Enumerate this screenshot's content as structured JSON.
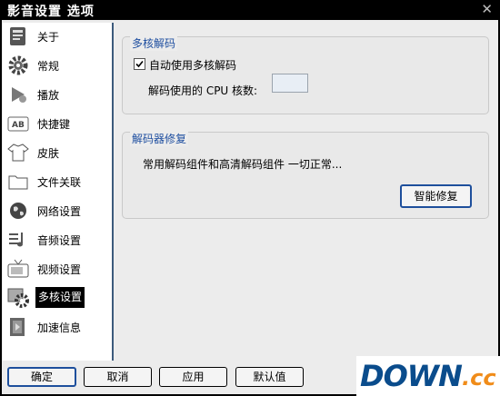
{
  "window": {
    "title": "影音设置 选项",
    "close_symbol": "✕"
  },
  "sidebar": {
    "items": [
      {
        "label": "关于",
        "icon": "about-icon"
      },
      {
        "label": "常规",
        "icon": "gear-icon"
      },
      {
        "label": "播放",
        "icon": "play-icon"
      },
      {
        "label": "快捷键",
        "icon": "keyboard-icon"
      },
      {
        "label": "皮肤",
        "icon": "shirt-icon"
      },
      {
        "label": "文件关联",
        "icon": "folder-icon"
      },
      {
        "label": "网络设置",
        "icon": "globe-icon"
      },
      {
        "label": "音频设置",
        "icon": "audio-icon"
      },
      {
        "label": "视频设置",
        "icon": "tv-icon"
      },
      {
        "label": "多核设置",
        "icon": "multicore-icon",
        "selected": true
      },
      {
        "label": "加速信息",
        "icon": "speed-icon"
      }
    ]
  },
  "multicore": {
    "title": "多核解码",
    "auto_checkbox_label": "自动使用多核解码",
    "auto_checked": true,
    "cpu_cores_label": "解码使用的 CPU 核数:",
    "cpu_cores_value": ""
  },
  "repair": {
    "title": "解码器修复",
    "status": "常用解码组件和高清解码组件 一切正常...",
    "repair_button": "智能修复"
  },
  "footer": {
    "ok": "确定",
    "cancel": "取消",
    "apply": "应用",
    "default": "默认值"
  },
  "watermark": {
    "part1": "DOWN",
    "part2": ".cc"
  }
}
